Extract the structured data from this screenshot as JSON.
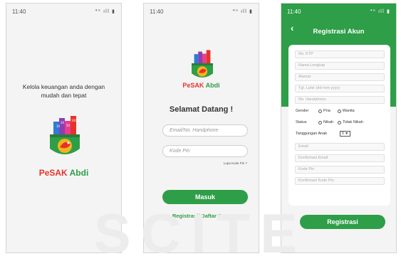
{
  "status_time": "11:40",
  "status_signal": "⁴ᴳ ıll",
  "splash": {
    "tagline_line1": "Kelola keuangan anda dengan",
    "tagline_line2": "mudah dan tepat",
    "brand_pe": "Pe",
    "brand_sak": "SAK",
    "brand_abdi": "Abdi"
  },
  "login": {
    "brand_pe": "Pe",
    "brand_sak": "SAK",
    "brand_abdi": "Abdi",
    "welcome": "Selamat Datang !",
    "email_placeholder": "Email/No. Handphone",
    "pin_placeholder": "Kode Pin",
    "forgot_label": "Lupa Kode Pin ?",
    "login_button": "Masuk",
    "register_link": "Registrasi/ Daftar Baru"
  },
  "register": {
    "title": "Registrasi Akun",
    "back_icon": "‹",
    "fields_top": [
      "No. KTP",
      "Nama Lengkap",
      "Alamat",
      "Tgl. Lahir (dd-mm-yyyy)",
      "No. Handphone"
    ],
    "gender_label": "Gender",
    "gender_options": [
      "Pria",
      "Wanita"
    ],
    "status_label": "Status",
    "status_options": [
      "Nikah",
      "Tidak Nikah"
    ],
    "dependents_label": "Tanggungan Anak",
    "dependents_value": "0 ▼",
    "fields_bottom": [
      "Email",
      "Konfirmasi Email",
      "Kode Pin",
      "Konfirmasi Kode Pin"
    ],
    "submit_button": "Registrasi"
  },
  "watermark": "SCITE",
  "colors": {
    "primary_green": "#2e9e48",
    "accent_red": "#e6332a",
    "stripe_blue": "#2f7bd6",
    "stripe_purple": "#8a3fb2",
    "stripe_pink": "#e83c8c"
  },
  "logo_numbers": [
    "10",
    "20",
    "50",
    "100"
  ]
}
